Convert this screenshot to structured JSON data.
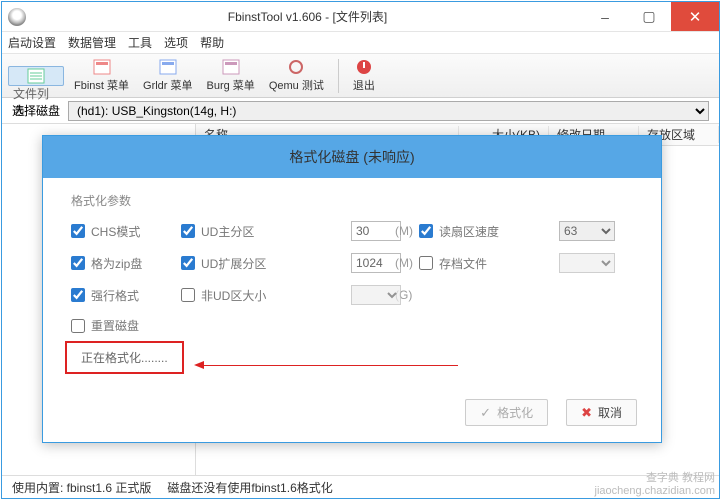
{
  "window": {
    "title": "FbinstTool v1.606 - [文件列表]"
  },
  "win_btns": {
    "min": "–",
    "max": "▢",
    "close": "✕"
  },
  "menubar": [
    "启动设置",
    "数据管理",
    "工具",
    "选项",
    "帮助"
  ],
  "toolbar": {
    "file_list": "文件列表",
    "fbinst_menu": "Fbinst 菜单",
    "grldr_menu": "Grldr 菜单",
    "burg_menu": "Burg 菜单",
    "qemu_test": "Qemu 测试",
    "exit": "退出"
  },
  "disk": {
    "label": "选择磁盘",
    "selected": "(hd1): USB_Kingston(14g, H:)"
  },
  "columns": {
    "name": "名称",
    "size": "大小(KB)",
    "mtime": "修改日期",
    "area": "存放区域"
  },
  "dialog": {
    "title": "格式化磁盘 (未响应)",
    "group": "格式化参数",
    "chs": "CHS模式",
    "zip": "格为zip盘",
    "force": "强行格式",
    "reset": "重置磁盘",
    "ud_main": "UD主分区",
    "ud_ext": "UD扩展分区",
    "nonud": "非UD区大小",
    "ud_main_val": "30",
    "ud_ext_val": "1024",
    "unit_m": "(M)",
    "unit_g": "(G)",
    "read_speed": "读扇区速度",
    "read_speed_val": "63",
    "archive": "存档文件",
    "status": "正在格式化........",
    "fmt_btn": "格式化",
    "cancel_btn": "取消"
  },
  "status": {
    "builtin": "使用内置: fbinst1.6 正式版",
    "note": "磁盘还没有使用fbinst1.6格式化"
  },
  "watermark": {
    "l1": "查字典 教程网",
    "l2": "jiaocheng.chazidian.com"
  }
}
